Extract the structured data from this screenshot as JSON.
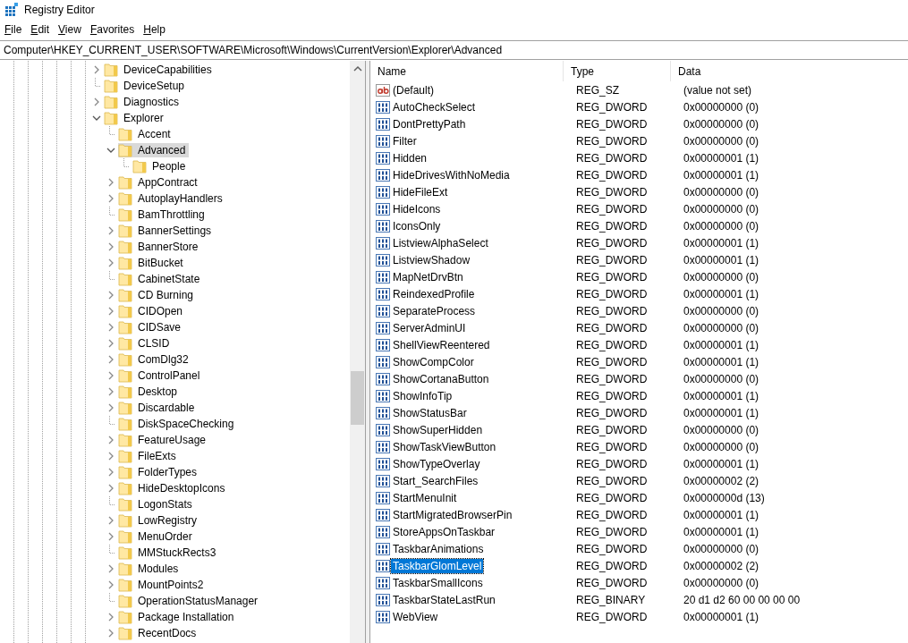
{
  "window": {
    "title": "Registry Editor"
  },
  "menu": [
    "File",
    "Edit",
    "View",
    "Favorites",
    "Help"
  ],
  "address": "Computer\\HKEY_CURRENT_USER\\SOFTWARE\\Microsoft\\Windows\\CurrentVersion\\Explorer\\Advanced",
  "tree": [
    {
      "name": "DeviceCapabilities",
      "expandable": true,
      "expanded": false,
      "selected": false
    },
    {
      "name": "DeviceSetup",
      "expandable": false,
      "selected": false
    },
    {
      "name": "Diagnostics",
      "expandable": true,
      "expanded": false,
      "selected": false
    },
    {
      "name": "Explorer",
      "expandable": true,
      "expanded": true,
      "selected": false,
      "children": [
        {
          "name": "Accent",
          "expandable": false,
          "selected": false
        },
        {
          "name": "Advanced",
          "expandable": true,
          "expanded": true,
          "selected": true,
          "children": [
            {
              "name": "People",
              "expandable": false,
              "selected": false
            }
          ]
        },
        {
          "name": "AppContract",
          "expandable": true,
          "expanded": false,
          "selected": false
        },
        {
          "name": "AutoplayHandlers",
          "expandable": true,
          "expanded": false,
          "selected": false
        },
        {
          "name": "BamThrottling",
          "expandable": false,
          "selected": false
        },
        {
          "name": "BannerSettings",
          "expandable": true,
          "expanded": false,
          "selected": false
        },
        {
          "name": "BannerStore",
          "expandable": true,
          "expanded": false,
          "selected": false
        },
        {
          "name": "BitBucket",
          "expandable": true,
          "expanded": false,
          "selected": false
        },
        {
          "name": "CabinetState",
          "expandable": false,
          "selected": false
        },
        {
          "name": "CD Burning",
          "expandable": true,
          "expanded": false,
          "selected": false
        },
        {
          "name": "CIDOpen",
          "expandable": true,
          "expanded": false,
          "selected": false
        },
        {
          "name": "CIDSave",
          "expandable": true,
          "expanded": false,
          "selected": false
        },
        {
          "name": "CLSID",
          "expandable": true,
          "expanded": false,
          "selected": false
        },
        {
          "name": "ComDlg32",
          "expandable": true,
          "expanded": false,
          "selected": false
        },
        {
          "name": "ControlPanel",
          "expandable": true,
          "expanded": false,
          "selected": false
        },
        {
          "name": "Desktop",
          "expandable": true,
          "expanded": false,
          "selected": false
        },
        {
          "name": "Discardable",
          "expandable": true,
          "expanded": false,
          "selected": false
        },
        {
          "name": "DiskSpaceChecking",
          "expandable": false,
          "selected": false
        },
        {
          "name": "FeatureUsage",
          "expandable": true,
          "expanded": false,
          "selected": false
        },
        {
          "name": "FileExts",
          "expandable": true,
          "expanded": false,
          "selected": false
        },
        {
          "name": "FolderTypes",
          "expandable": true,
          "expanded": false,
          "selected": false
        },
        {
          "name": "HideDesktopIcons",
          "expandable": true,
          "expanded": false,
          "selected": false
        },
        {
          "name": "LogonStats",
          "expandable": false,
          "selected": false
        },
        {
          "name": "LowRegistry",
          "expandable": true,
          "expanded": false,
          "selected": false
        },
        {
          "name": "MenuOrder",
          "expandable": true,
          "expanded": false,
          "selected": false
        },
        {
          "name": "MMStuckRects3",
          "expandable": false,
          "selected": false
        },
        {
          "name": "Modules",
          "expandable": true,
          "expanded": false,
          "selected": false
        },
        {
          "name": "MountPoints2",
          "expandable": true,
          "expanded": false,
          "selected": false
        },
        {
          "name": "OperationStatusManager",
          "expandable": false,
          "selected": false
        },
        {
          "name": "Package Installation",
          "expandable": true,
          "expanded": false,
          "selected": false
        },
        {
          "name": "RecentDocs",
          "expandable": true,
          "expanded": false,
          "selected": false
        }
      ]
    }
  ],
  "table": {
    "columns": [
      "Name",
      "Type",
      "Data"
    ],
    "rows": [
      {
        "name": "(Default)",
        "kind": "string",
        "type": "REG_SZ",
        "data": "(value not set)",
        "selected": false
      },
      {
        "name": "AutoCheckSelect",
        "kind": "binary",
        "type": "REG_DWORD",
        "data": "0x00000000 (0)",
        "selected": false
      },
      {
        "name": "DontPrettyPath",
        "kind": "binary",
        "type": "REG_DWORD",
        "data": "0x00000000 (0)",
        "selected": false
      },
      {
        "name": "Filter",
        "kind": "binary",
        "type": "REG_DWORD",
        "data": "0x00000000 (0)",
        "selected": false
      },
      {
        "name": "Hidden",
        "kind": "binary",
        "type": "REG_DWORD",
        "data": "0x00000001 (1)",
        "selected": false
      },
      {
        "name": "HideDrivesWithNoMedia",
        "kind": "binary",
        "type": "REG_DWORD",
        "data": "0x00000001 (1)",
        "selected": false
      },
      {
        "name": "HideFileExt",
        "kind": "binary",
        "type": "REG_DWORD",
        "data": "0x00000000 (0)",
        "selected": false
      },
      {
        "name": "HideIcons",
        "kind": "binary",
        "type": "REG_DWORD",
        "data": "0x00000000 (0)",
        "selected": false
      },
      {
        "name": "IconsOnly",
        "kind": "binary",
        "type": "REG_DWORD",
        "data": "0x00000000 (0)",
        "selected": false
      },
      {
        "name": "ListviewAlphaSelect",
        "kind": "binary",
        "type": "REG_DWORD",
        "data": "0x00000001 (1)",
        "selected": false
      },
      {
        "name": "ListviewShadow",
        "kind": "binary",
        "type": "REG_DWORD",
        "data": "0x00000001 (1)",
        "selected": false
      },
      {
        "name": "MapNetDrvBtn",
        "kind": "binary",
        "type": "REG_DWORD",
        "data": "0x00000000 (0)",
        "selected": false
      },
      {
        "name": "ReindexedProfile",
        "kind": "binary",
        "type": "REG_DWORD",
        "data": "0x00000001 (1)",
        "selected": false
      },
      {
        "name": "SeparateProcess",
        "kind": "binary",
        "type": "REG_DWORD",
        "data": "0x00000000 (0)",
        "selected": false
      },
      {
        "name": "ServerAdminUI",
        "kind": "binary",
        "type": "REG_DWORD",
        "data": "0x00000000 (0)",
        "selected": false
      },
      {
        "name": "ShellViewReentered",
        "kind": "binary",
        "type": "REG_DWORD",
        "data": "0x00000001 (1)",
        "selected": false
      },
      {
        "name": "ShowCompColor",
        "kind": "binary",
        "type": "REG_DWORD",
        "data": "0x00000001 (1)",
        "selected": false
      },
      {
        "name": "ShowCortanaButton",
        "kind": "binary",
        "type": "REG_DWORD",
        "data": "0x00000000 (0)",
        "selected": false
      },
      {
        "name": "ShowInfoTip",
        "kind": "binary",
        "type": "REG_DWORD",
        "data": "0x00000001 (1)",
        "selected": false
      },
      {
        "name": "ShowStatusBar",
        "kind": "binary",
        "type": "REG_DWORD",
        "data": "0x00000001 (1)",
        "selected": false
      },
      {
        "name": "ShowSuperHidden",
        "kind": "binary",
        "type": "REG_DWORD",
        "data": "0x00000000 (0)",
        "selected": false
      },
      {
        "name": "ShowTaskViewButton",
        "kind": "binary",
        "type": "REG_DWORD",
        "data": "0x00000000 (0)",
        "selected": false
      },
      {
        "name": "ShowTypeOverlay",
        "kind": "binary",
        "type": "REG_DWORD",
        "data": "0x00000001 (1)",
        "selected": false
      },
      {
        "name": "Start_SearchFiles",
        "kind": "binary",
        "type": "REG_DWORD",
        "data": "0x00000002 (2)",
        "selected": false
      },
      {
        "name": "StartMenuInit",
        "kind": "binary",
        "type": "REG_DWORD",
        "data": "0x0000000d (13)",
        "selected": false
      },
      {
        "name": "StartMigratedBrowserPin",
        "kind": "binary",
        "type": "REG_DWORD",
        "data": "0x00000001 (1)",
        "selected": false
      },
      {
        "name": "StoreAppsOnTaskbar",
        "kind": "binary",
        "type": "REG_DWORD",
        "data": "0x00000001 (1)",
        "selected": false
      },
      {
        "name": "TaskbarAnimations",
        "kind": "binary",
        "type": "REG_DWORD",
        "data": "0x00000000 (0)",
        "selected": false
      },
      {
        "name": "TaskbarGlomLevel",
        "kind": "binary",
        "type": "REG_DWORD",
        "data": "0x00000002 (2)",
        "selected": true
      },
      {
        "name": "TaskbarSmallIcons",
        "kind": "binary",
        "type": "REG_DWORD",
        "data": "0x00000000 (0)",
        "selected": false
      },
      {
        "name": "TaskbarStateLastRun",
        "kind": "binary",
        "type": "REG_BINARY",
        "data": "20 d1 d2 60 00 00 00 00",
        "selected": false
      },
      {
        "name": "WebView",
        "kind": "binary",
        "type": "REG_DWORD",
        "data": "0x00000001 (1)",
        "selected": false
      }
    ]
  }
}
